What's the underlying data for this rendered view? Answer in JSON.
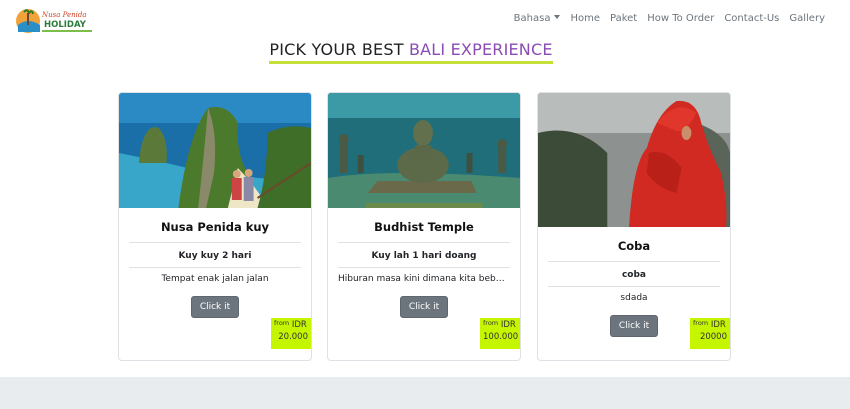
{
  "navbar": {
    "logo_text_top": "Nusa Penida",
    "logo_text_main": "HOLIDAY",
    "items": [
      {
        "label": "Bahasa",
        "dropdown": true
      },
      {
        "label": "Home"
      },
      {
        "label": "Paket"
      },
      {
        "label": "How To Order"
      },
      {
        "label": "Contact-Us"
      },
      {
        "label": "Gallery"
      }
    ]
  },
  "heading": {
    "prefix": "PICK YOUR BEST",
    "accent": "BALI EXPERIENCE"
  },
  "cards": [
    {
      "title": "Nusa Penida kuy",
      "subtitle": "Kuy kuy 2 hari",
      "description": "Tempat enak jalan jalan",
      "button": "Click it",
      "price_from": "from",
      "price_currency": "IDR",
      "price_amount": "20.000",
      "image": "cliff-beach-photo"
    },
    {
      "title": "Budhist Temple",
      "subtitle": "Kuy lah 1 hari doang",
      "description": "Hiburan masa kini dimana kita bebas berex...",
      "button": "Click it",
      "price_from": "from",
      "price_currency": "IDR",
      "price_amount": "100.000",
      "image": "underwater-temple-photo"
    },
    {
      "title": "Coba",
      "subtitle": "coba",
      "description": "sdada",
      "button": "Click it",
      "price_from": "from",
      "price_currency": "IDR",
      "price_amount": "20000",
      "image": "red-jacket-person-photo"
    }
  ],
  "colors": {
    "accent_purple": "#8a4bb5",
    "underline_lime": "#c6e03a",
    "price_tag": "#c6f500",
    "button_gray": "#6c757d",
    "footer_band": "#e9ecef"
  }
}
